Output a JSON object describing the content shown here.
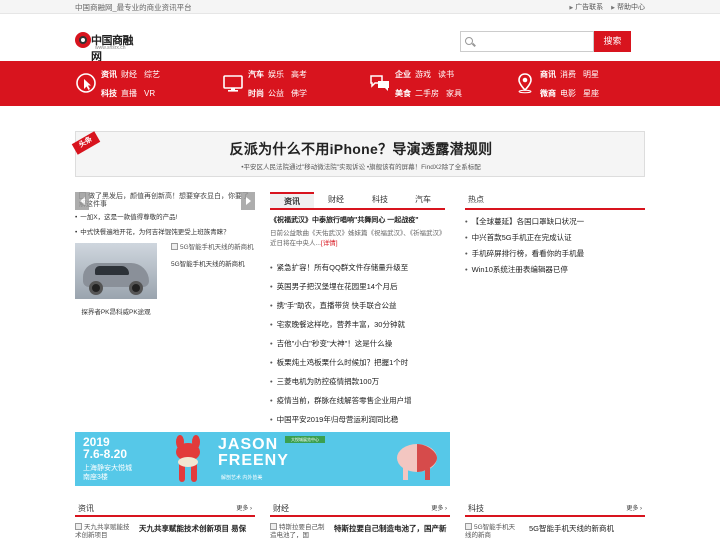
{
  "topbar": {
    "slogan": "中国商融网_最专业的商业资讯平台",
    "link_ad": "广告联系",
    "link_help": "帮助中心"
  },
  "logo": {
    "name": "中国商融网",
    "url": "www.snsrx.cn"
  },
  "search": {
    "placeholder": "",
    "button": "搜索"
  },
  "nav": [
    {
      "icon": "cursor-click-icon",
      "row1": [
        "资讯",
        "财经",
        "综艺"
      ],
      "row2": [
        "科技",
        "直播",
        "VR"
      ]
    },
    {
      "icon": "monitor-icon",
      "row1": [
        "汽车",
        "娱乐",
        "高考"
      ],
      "row2": [
        "时尚",
        "公益",
        "佛学"
      ]
    },
    {
      "icon": "chat-bubbles-icon",
      "row1": [
        "企业",
        "游戏",
        "读书"
      ],
      "row2": [
        "美食",
        "二手房",
        "家具"
      ]
    },
    {
      "icon": "location-pin-icon",
      "row1": [
        "商讯",
        "消费",
        "明星"
      ],
      "row2": [
        "微商",
        "电影",
        "星座"
      ]
    }
  ],
  "headline": {
    "ribbon": "头条",
    "title": "反派为什么不用iPhone？导演透露潜规则",
    "subs": [
      "•平安区人民法院通过\"移动微法院\"实现诉讼",
      "•旗舰该有的屏幕！FindX2除了全系标配"
    ]
  },
  "left": {
    "slider_text": "做了黑发后，颜值再创新高！想要穿衣显白，你要了解这件事",
    "list": [
      "一加X，这是一款值得尊敬的产品!",
      "中式快餐遍地开花，为何吉祥馄饨更受上班族青睐？"
    ],
    "car_caption": "探界者PK昂科威PK途观",
    "side_img_alt": "5G智能手机天线的新商机",
    "side_caption": "5G智能手机天线的新商机"
  },
  "middle": {
    "tabs": [
      "资讯",
      "财经",
      "科技",
      "汽车"
    ],
    "lead_title": "《祝福武汉》中泰旅行唱响\"共舞同心 一起战疫\"",
    "lead_desc": "日前公益歌曲《天佑武汉》姊妹篇《祝福武汉》、《祈福武汉》近日将在中央人...",
    "lead_more": "[详情]",
    "list": [
      "紧急扩容！所有QQ群文件存储量升级至",
      "英国男子把汉堡埋在花园里14个月后",
      "携\"手\"助农，直播带货 快手联合公益",
      "宅家晚餐这样吃，营养丰富，30分钟就",
      "吉他\"小白\"秒变\"大神\"！这是什么操",
      "板栗炖土鸡板栗什么时候加？把握1个时",
      "三菱电机为防控疫情捐款100万",
      "疫情当前，群脉在线解答零售企业用户增",
      "中国平安2019年归母营运利润同比稳"
    ]
  },
  "right": {
    "head": "热点",
    "list": [
      "【全球蔓延】各国口罩缺口状况一",
      "中兴首款5G手机正在完成认证",
      "手机碎屏排行榜，看看你的手机最",
      "Win10系统注册表编辑器已停"
    ]
  },
  "ad": {
    "year": "2019",
    "date": "7.6-8.20",
    "place1": "上海静安大悦城",
    "place2": "南座3楼",
    "brand1": "JASON",
    "brand2": "FREENY",
    "tag": "大悦城展览中心",
    "sub": "解剖艺术 内外皆美"
  },
  "bottom": [
    {
      "head": "资讯",
      "more": "更多",
      "img_alt": "天九共享赋能技术创新项目",
      "title": "天九共享赋能技术创新项目 易保",
      "bold": true
    },
    {
      "head": "财经",
      "more": "更多",
      "img_alt": "特斯拉要自己制造电池了，国",
      "title": "特斯拉要自己制造电池了，国产新",
      "bold": true
    },
    {
      "head": "科技",
      "more": "更多",
      "img_alt": "5G智能手机天线的新商",
      "title": "5G智能手机天线的新商机",
      "bold": false
    }
  ],
  "colors": {
    "brand_red": "#d8141e",
    "ad_blue": "#56c8e8"
  }
}
